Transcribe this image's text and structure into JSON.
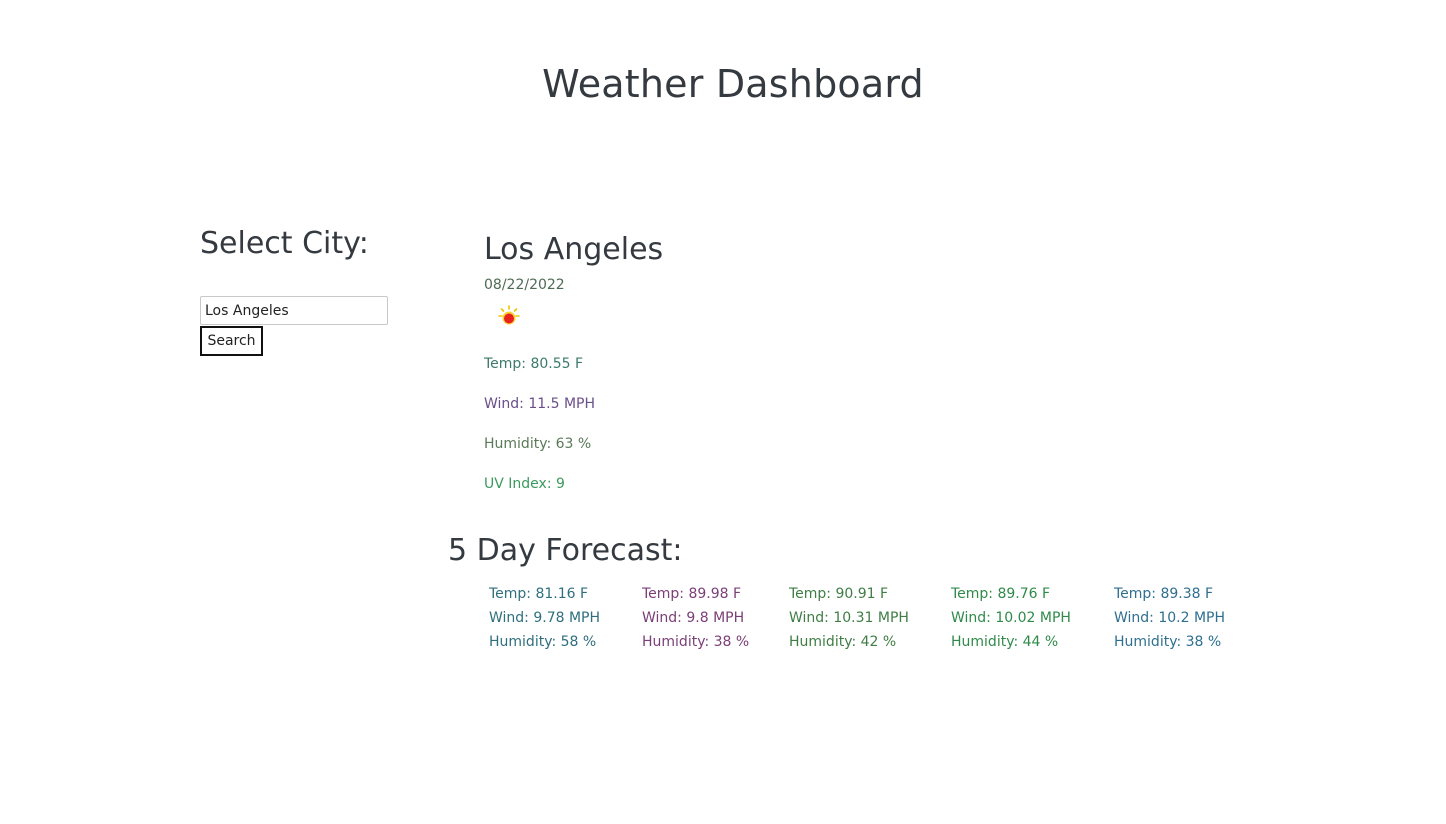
{
  "page": {
    "title": "Weather Dashboard"
  },
  "sidebar": {
    "heading": "Select City:",
    "search_value": "Los Angeles",
    "search_button_label": "Search"
  },
  "current": {
    "city": "Los Angeles",
    "date": "08/22/2022",
    "icon": "sunny-icon",
    "temp": "Temp: 80.55 F",
    "wind": "Wind: 11.5 MPH",
    "humidity": "Humidity: 63 %",
    "uv_index": "UV Index: 9"
  },
  "forecast": {
    "heading": "5 Day Forecast:",
    "days": [
      {
        "temp": "Temp: 81.16 F",
        "wind": "Wind: 9.78 MPH",
        "humidity": "Humidity: 58 %"
      },
      {
        "temp": "Temp: 89.98 F",
        "wind": "Wind: 9.8 MPH",
        "humidity": "Humidity: 38 %"
      },
      {
        "temp": "Temp: 90.91 F",
        "wind": "Wind: 10.31 MPH",
        "humidity": "Humidity: 42 %"
      },
      {
        "temp": "Temp: 89.76 F",
        "wind": "Wind: 10.02 MPH",
        "humidity": "Humidity: 44 %"
      },
      {
        "temp": "Temp: 89.38 F",
        "wind": "Wind: 10.2 MPH",
        "humidity": "Humidity: 38 %"
      }
    ]
  },
  "colors": {
    "heading": "#343a40",
    "sun_core": "#e8221c",
    "sun_rays": "#f2c500"
  }
}
